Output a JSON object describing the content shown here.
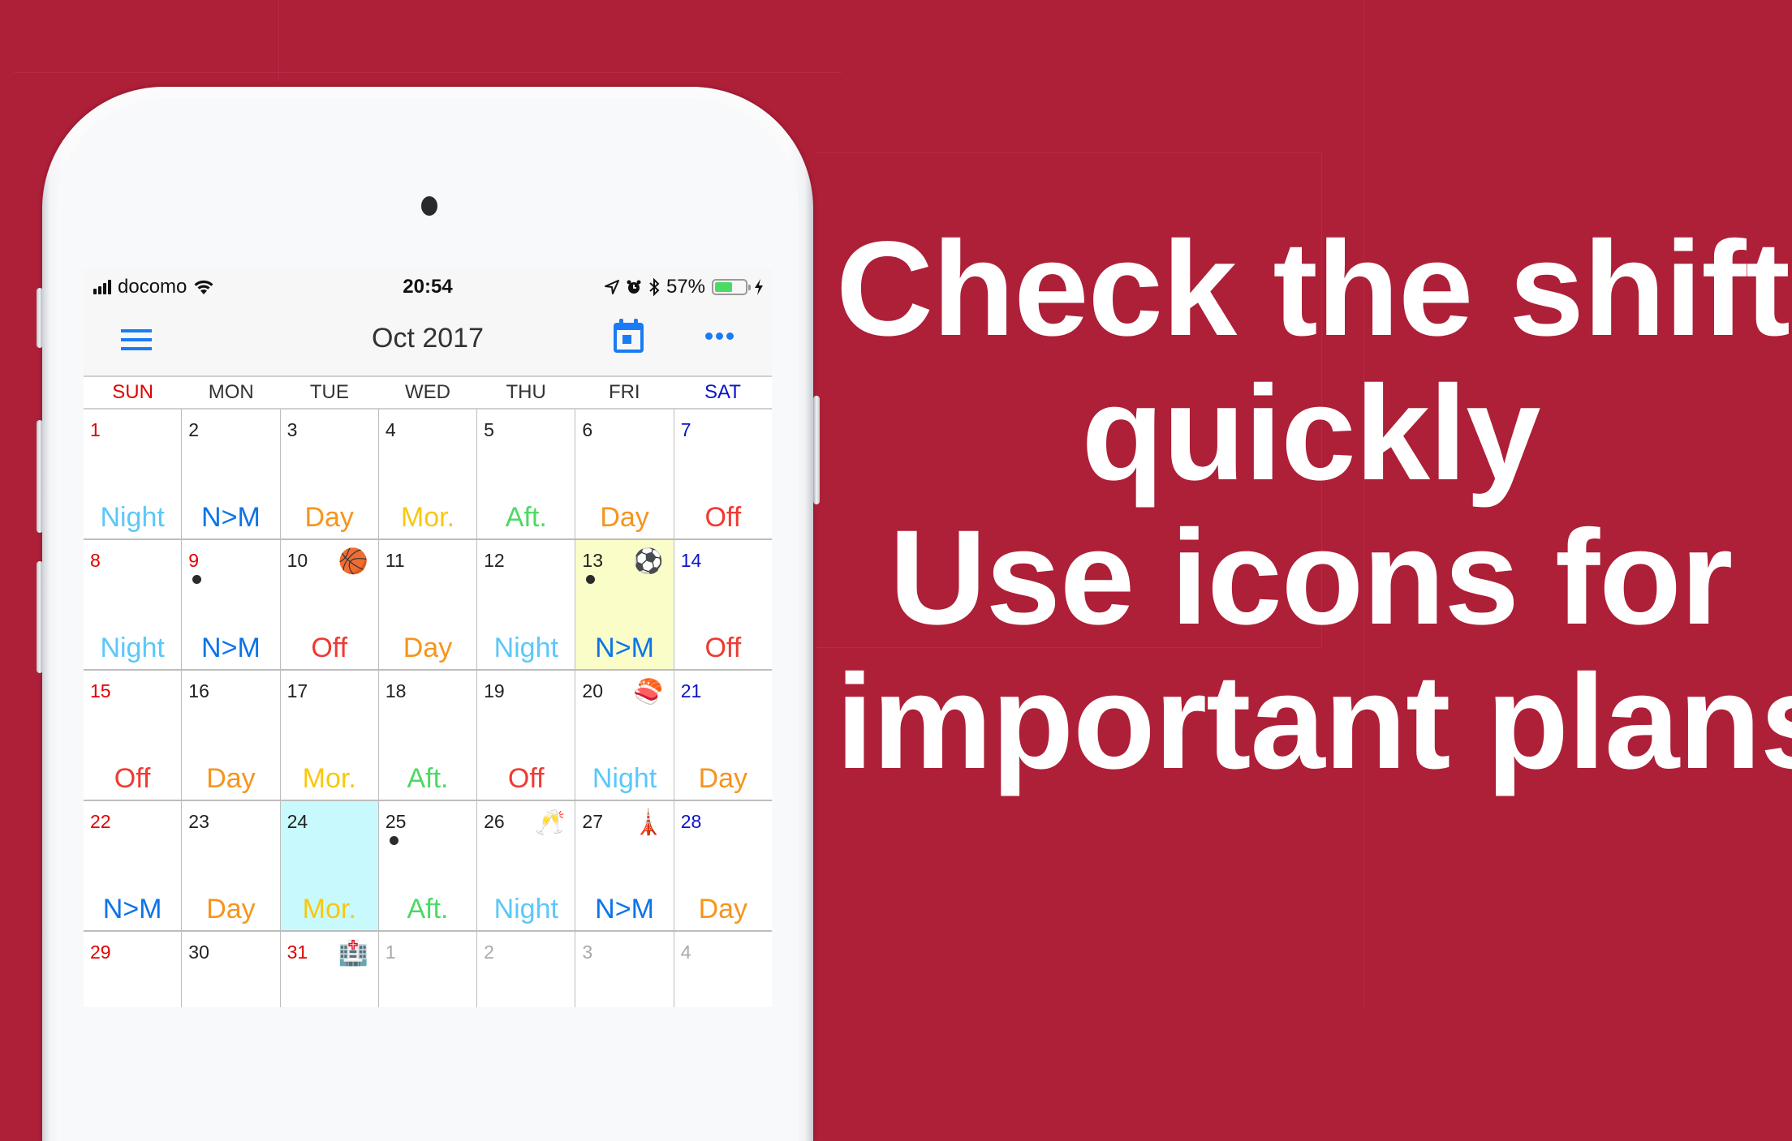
{
  "headline": {
    "lines": [
      "Check the shifts",
      "quickly",
      "Use icons for",
      "important plans"
    ]
  },
  "status_bar": {
    "carrier": "docomo",
    "time": "20:54",
    "battery": "57%",
    "battery_level": 0.57,
    "icons": [
      "signal-icon",
      "wifi-icon",
      "location-icon",
      "alarm-icon",
      "bluetooth-icon",
      "battery-icon",
      "charging-icon"
    ]
  },
  "navbar": {
    "title": "Oct 2017",
    "menu_icon": "hamburger-menu-icon",
    "today_icon": "calendar-today-icon",
    "more_icon": "more-dots-icon",
    "accent_color": "#1A7CF5"
  },
  "weekdays": [
    "SUN",
    "MON",
    "TUE",
    "WED",
    "THU",
    "FRI",
    "SAT"
  ],
  "shift_colors": {
    "Night": "#5AC8FA",
    "N>M": "#0A74E8",
    "Day": "#F7941D",
    "Mor.": "#F9C80E",
    "Aft.": "#4CD964",
    "Off": "#F03A32"
  },
  "calendar": {
    "weeks": [
      [
        {
          "day": "1",
          "type": "sun",
          "shift": "Night"
        },
        {
          "day": "2",
          "type": "",
          "shift": "N>M"
        },
        {
          "day": "3",
          "type": "",
          "shift": "Day"
        },
        {
          "day": "4",
          "type": "",
          "shift": "Mor."
        },
        {
          "day": "5",
          "type": "",
          "shift": "Aft."
        },
        {
          "day": "6",
          "type": "",
          "shift": "Day"
        },
        {
          "day": "7",
          "type": "sat",
          "shift": "Off"
        }
      ],
      [
        {
          "day": "8",
          "type": "sun",
          "shift": "Night"
        },
        {
          "day": "9",
          "type": "sun",
          "shift": "N>M",
          "dot": true
        },
        {
          "day": "10",
          "type": "",
          "shift": "Off",
          "icon": "🏀",
          "icon_name": "basketball-icon"
        },
        {
          "day": "11",
          "type": "",
          "shift": "Day"
        },
        {
          "day": "12",
          "type": "",
          "shift": "Night"
        },
        {
          "day": "13",
          "type": "",
          "shift": "N>M",
          "dot": true,
          "icon": "⚽",
          "icon_name": "soccer-ball-icon",
          "highlight": "today"
        },
        {
          "day": "14",
          "type": "sat",
          "shift": "Off"
        }
      ],
      [
        {
          "day": "15",
          "type": "sun",
          "shift": "Off"
        },
        {
          "day": "16",
          "type": "",
          "shift": "Day"
        },
        {
          "day": "17",
          "type": "",
          "shift": "Mor."
        },
        {
          "day": "18",
          "type": "",
          "shift": "Aft."
        },
        {
          "day": "19",
          "type": "",
          "shift": "Off"
        },
        {
          "day": "20",
          "type": "",
          "shift": "Night",
          "icon": "🍣",
          "icon_name": "sushi-icon"
        },
        {
          "day": "21",
          "type": "sat",
          "shift": "Day"
        }
      ],
      [
        {
          "day": "22",
          "type": "sun",
          "shift": "N>M"
        },
        {
          "day": "23",
          "type": "",
          "shift": "Day"
        },
        {
          "day": "24",
          "type": "",
          "shift": "Mor.",
          "highlight": "selected"
        },
        {
          "day": "25",
          "type": "",
          "shift": "Aft.",
          "dot": true
        },
        {
          "day": "26",
          "type": "",
          "shift": "Night",
          "icon": "🥂",
          "icon_name": "champagne-toast-icon"
        },
        {
          "day": "27",
          "type": "",
          "shift": "N>M",
          "icon": "🗼",
          "icon_name": "tokyo-tower-icon"
        },
        {
          "day": "28",
          "type": "sat",
          "shift": "Day"
        }
      ],
      [
        {
          "day": "29",
          "type": "sun",
          "shift": ""
        },
        {
          "day": "30",
          "type": "",
          "shift": ""
        },
        {
          "day": "31",
          "type": "sun",
          "shift": "",
          "icon": "🏥",
          "icon_name": "hospital-icon"
        },
        {
          "day": "1",
          "type": "other",
          "shift": ""
        },
        {
          "day": "2",
          "type": "other",
          "shift": ""
        },
        {
          "day": "3",
          "type": "other",
          "shift": ""
        },
        {
          "day": "4",
          "type": "other",
          "shift": ""
        }
      ]
    ]
  }
}
